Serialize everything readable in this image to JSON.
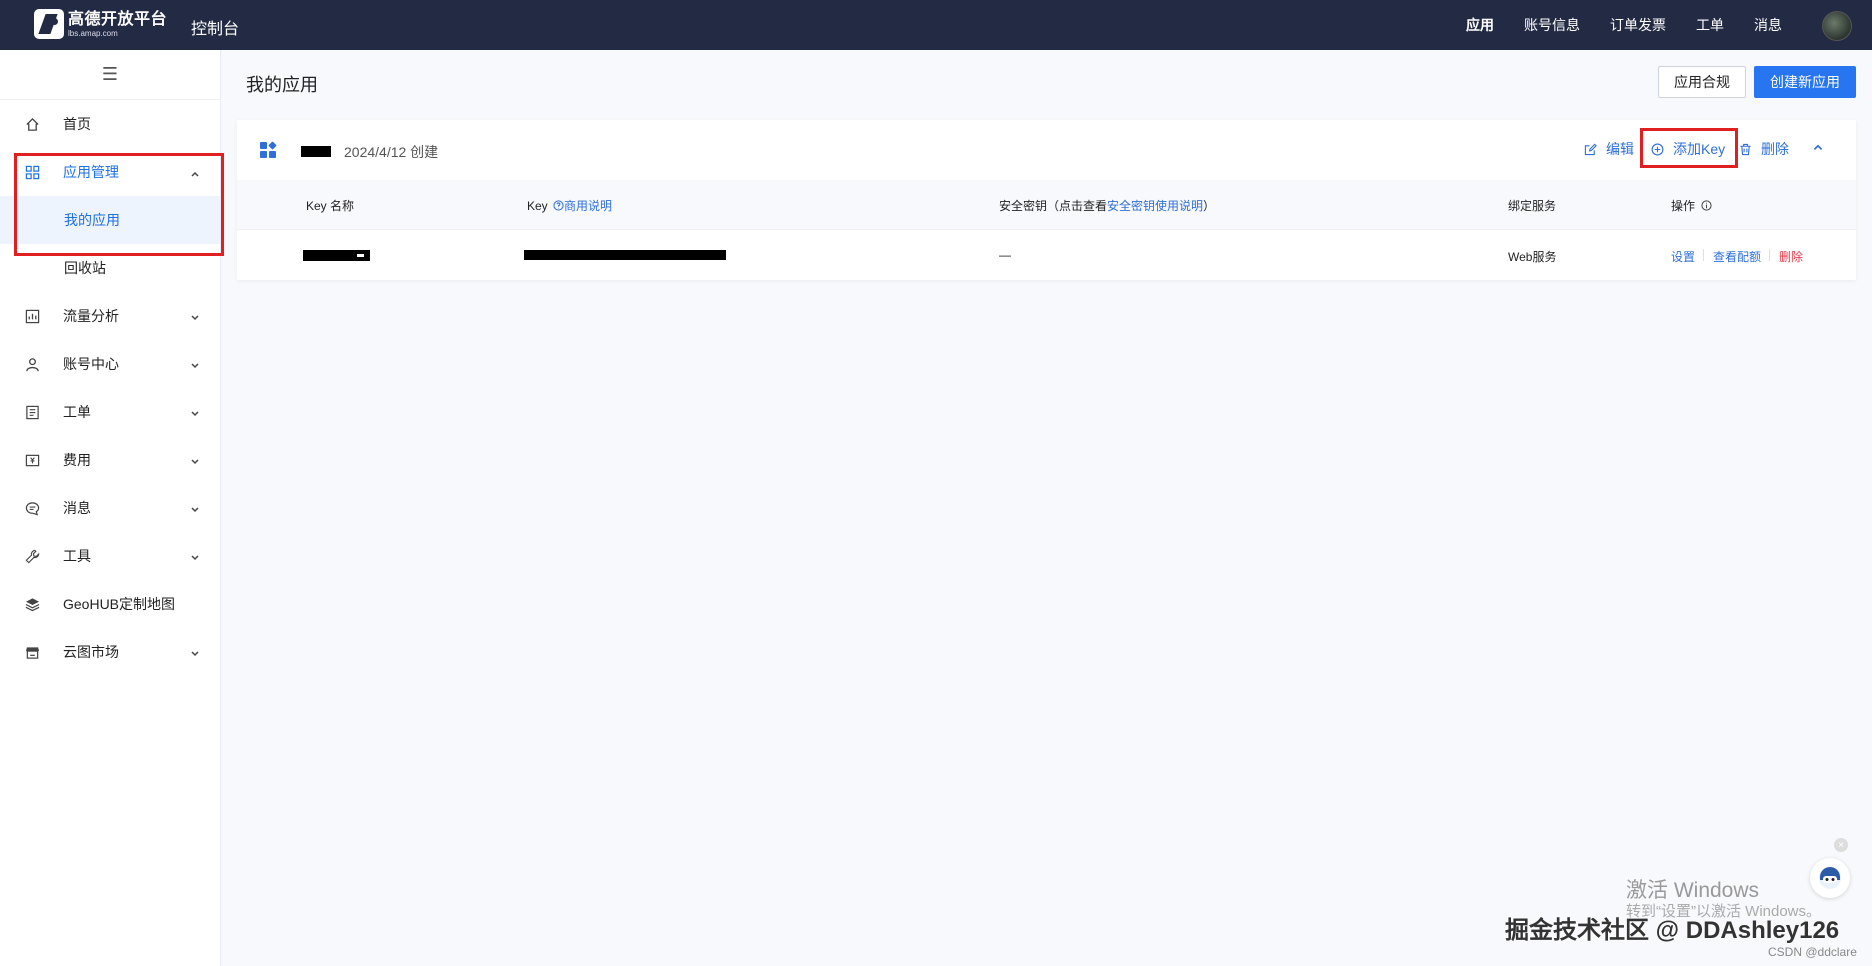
{
  "header": {
    "logo_name": "高德开放平台",
    "logo_url": "lbs.amap.com",
    "console_title": "控制台",
    "nav": [
      "应用",
      "账号信息",
      "订单发票",
      "工单",
      "消息"
    ]
  },
  "sidebar": {
    "items": [
      {
        "label": "首页",
        "icon": "home-icon"
      },
      {
        "label": "应用管理",
        "icon": "apps-grid-icon",
        "open": true
      },
      {
        "label": "我的应用",
        "sub": true,
        "active": true
      },
      {
        "label": "回收站",
        "sub": true
      },
      {
        "label": "流量分析",
        "icon": "chart-icon"
      },
      {
        "label": "账号中心",
        "icon": "user-icon"
      },
      {
        "label": "工单",
        "icon": "ticket-icon"
      },
      {
        "label": "费用",
        "icon": "fee-icon"
      },
      {
        "label": "消息",
        "icon": "message-icon"
      },
      {
        "label": "工具",
        "icon": "wrench-icon"
      },
      {
        "label": "GeoHUB定制地图",
        "icon": "layers-icon"
      },
      {
        "label": "云图市场",
        "icon": "store-icon"
      }
    ]
  },
  "main": {
    "title": "我的应用",
    "compliance_button": "应用合规",
    "create_button": "创建新应用"
  },
  "app_card": {
    "created": "2024/4/12 创建",
    "actions": {
      "edit": "编辑",
      "add_key": "添加Key",
      "delete": "删除"
    },
    "columns": {
      "key_name": "Key 名称",
      "key": "Key",
      "key_link": "商用说明",
      "secret_prefix": "安全密钥（点击查看",
      "secret_link": "安全密钥使用说明",
      "secret_suffix": "）",
      "service": "绑定服务",
      "ops": "操作"
    },
    "rows": [
      {
        "secret": "—",
        "service": "Web服务",
        "ops": [
          "设置",
          "查看配额",
          "删除"
        ]
      }
    ]
  },
  "watermarks": {
    "windows_title": "激活 Windows",
    "windows_sub": "转到“设置”以激活 Windows。",
    "juejin": "掘金技术社区 @ DDAshley126",
    "csdn": "CSDN @ddclare"
  }
}
